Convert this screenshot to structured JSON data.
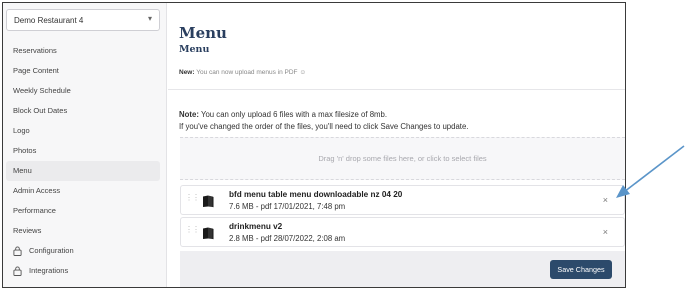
{
  "sidebar": {
    "restaurant_select": {
      "value": "Demo Restaurant 4",
      "caret": "▾"
    },
    "items": [
      {
        "label": "Reservations",
        "active": false,
        "locked": false
      },
      {
        "label": "Page Content",
        "active": false,
        "locked": false
      },
      {
        "label": "Weekly Schedule",
        "active": false,
        "locked": false
      },
      {
        "label": "Block Out Dates",
        "active": false,
        "locked": false
      },
      {
        "label": "Logo",
        "active": false,
        "locked": false
      },
      {
        "label": "Photos",
        "active": false,
        "locked": false
      },
      {
        "label": "Menu",
        "active": true,
        "locked": false
      },
      {
        "label": "Admin Access",
        "active": false,
        "locked": false
      },
      {
        "label": "Performance",
        "active": false,
        "locked": false
      },
      {
        "label": "Reviews",
        "active": false,
        "locked": false
      },
      {
        "label": "Configuration",
        "active": false,
        "locked": true
      },
      {
        "label": "Integrations",
        "active": false,
        "locked": true
      }
    ]
  },
  "main": {
    "title": "Menu",
    "subtitle": "Menu",
    "new_notice": {
      "label": "New:",
      "text": "You can now upload menus in PDF ☺"
    },
    "note": {
      "label": "Note:",
      "line1": "You can only upload 6 files with a max filesize of 8mb.",
      "line2": "If you've changed the order of the files, you'll need to click Save Changes to update."
    },
    "dropzone_text": "Drag 'n' drop some files here, or click to select files",
    "files": [
      {
        "name": "bfd menu table menu downloadable nz 04 20",
        "meta": "7.6 MB - pdf 17/01/2021, 7:48 pm",
        "remove": "×"
      },
      {
        "name": "drinkmenu v2",
        "meta": "2.8 MB - pdf 28/07/2022, 2:08 am",
        "remove": "×"
      }
    ],
    "save_button": "Save Changes"
  },
  "colors": {
    "accent": "#2c4a6b",
    "title": "#2a3f5f",
    "arrow": "#5b95c9"
  }
}
